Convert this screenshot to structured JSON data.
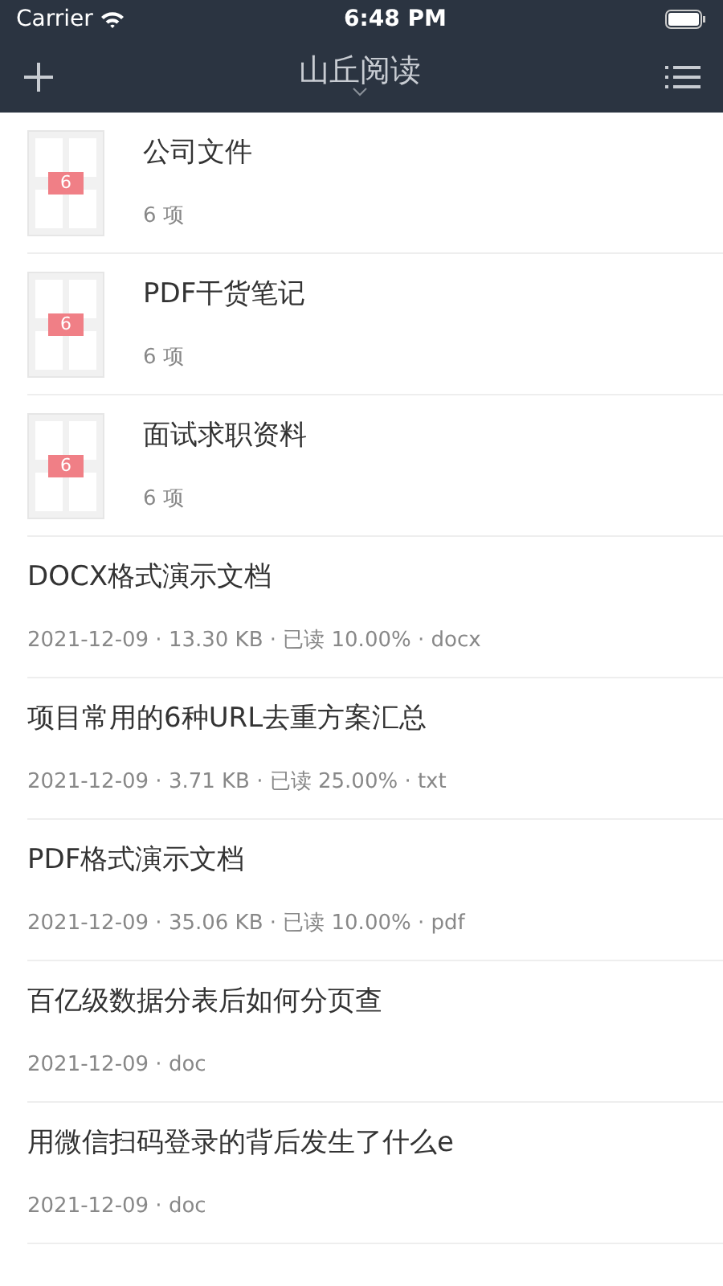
{
  "status_bar": {
    "carrier": "Carrier",
    "time": "6:48 PM"
  },
  "nav": {
    "title": "山丘阅读"
  },
  "folders": [
    {
      "name": "公司文件",
      "count": "6 项",
      "badge": "6"
    },
    {
      "name": "PDF干货笔记",
      "count": "6 项",
      "badge": "6"
    },
    {
      "name": "面试求职资料",
      "count": "6 项",
      "badge": "6"
    }
  ],
  "files": [
    {
      "name": "DOCX格式演示文档",
      "meta": "2021-12-09 · 13.30 KB · 已读 10.00% · docx"
    },
    {
      "name": "项目常用的6种URL去重方案汇总",
      "meta": "2021-12-09 · 3.71 KB · 已读 25.00% · txt"
    },
    {
      "name": "PDF格式演示文档",
      "meta": "2021-12-09 · 35.06 KB · 已读 10.00% · pdf"
    },
    {
      "name": "百亿级数据分表后如何分页查",
      "meta": "2021-12-09 · doc"
    },
    {
      "name": "用微信扫码登录的背后发生了什么e",
      "meta": "2021-12-09 · doc"
    }
  ]
}
